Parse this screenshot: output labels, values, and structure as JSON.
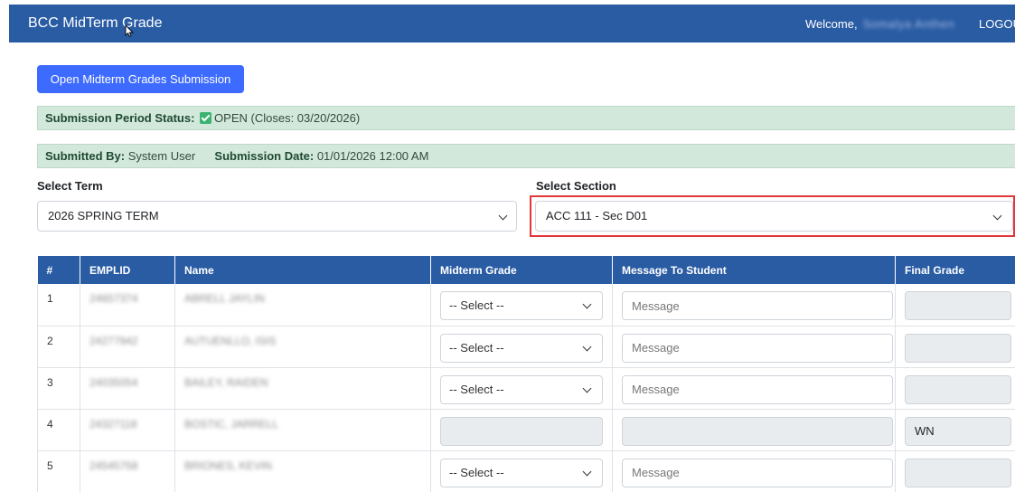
{
  "navbar": {
    "brand": "BCC MidTerm Grade",
    "welcome_label": "Welcome,",
    "user_name": "Somalya Anthen",
    "logout_label": "LOGOUT"
  },
  "open_button_label": "Open Midterm Grades Submission",
  "status": {
    "label": "Submission Period Status:",
    "value": "OPEN (Closes: 03/20/2026)"
  },
  "submission": {
    "submitted_by_label": "Submitted By:",
    "submitted_by_value": "System User",
    "date_label": "Submission Date:",
    "date_value": "01/01/2026 12:00 AM"
  },
  "term": {
    "label": "Select Term",
    "selected": "2026 SPRING TERM"
  },
  "section": {
    "label": "Select Section",
    "selected": "ACC 111 - Sec D01"
  },
  "table": {
    "headers": [
      "#",
      "EMPLID",
      "Name",
      "Midterm Grade",
      "Message To Student",
      "Final Grade"
    ],
    "select_placeholder": "-- Select --",
    "message_placeholder": "Message",
    "rows": [
      {
        "num": "1",
        "emplid": "24657374",
        "name": "ABRELL JAYLIN"
      },
      {
        "num": "2",
        "emplid": "24277942",
        "name": "AUTUENLLO, ISIS"
      },
      {
        "num": "3",
        "emplid": "24035054",
        "name": "BAILEY, RAIDEN"
      },
      {
        "num": "4",
        "emplid": "24327118",
        "name": "BOSTIC, JARRELL",
        "final": "WN"
      },
      {
        "num": "5",
        "emplid": "24545758",
        "name": "BRIONES, KEVIN"
      }
    ]
  },
  "colors": {
    "navbar": "#2a5ca4",
    "button": "#3d6bff",
    "alert_bg": "#d2e8da",
    "highlight": "#e2383c"
  }
}
